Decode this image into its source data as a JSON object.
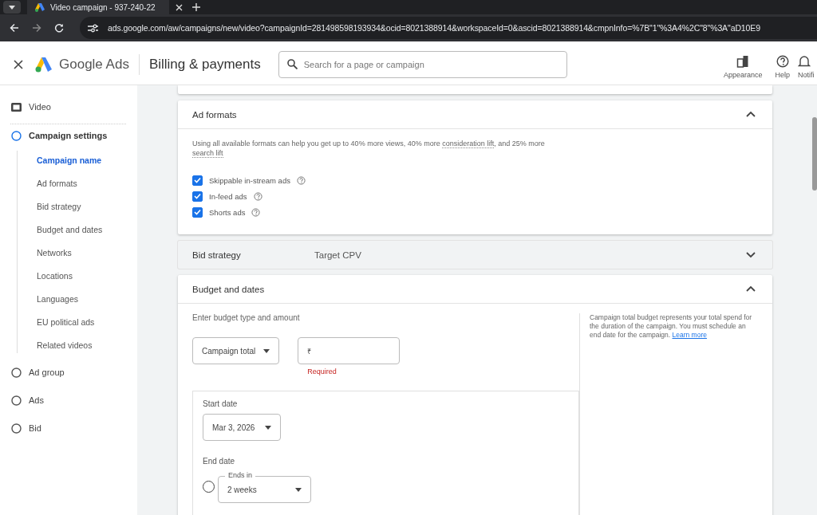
{
  "browser": {
    "tab_title": "Video campaign - 937-240-22",
    "url": "ads.google.com/aw/campaigns/new/video?campaignId=281498598193934&ocid=8021388914&workspaceId=0&ascid=8021388914&cmpnInfo=%7B\"1\"%3A4%2C\"8\"%3A\"aD10E9"
  },
  "header": {
    "app_name": "Google Ads",
    "page_title": "Billing & payments",
    "search": {
      "placeholder": "Search for a page or campaign"
    },
    "actions": [
      {
        "kind": "appearance",
        "label": "Appearance"
      },
      {
        "kind": "help",
        "label": "Help"
      },
      {
        "kind": "bell",
        "label": "Notifi"
      }
    ]
  },
  "sidebar": {
    "items": [
      {
        "kind": "video",
        "label": "Video",
        "selected": false
      },
      {
        "kind": "step",
        "label": "Campaign settings",
        "selected": true,
        "children": [
          {
            "label": "Campaign name",
            "selected": true
          },
          {
            "label": "Ad formats",
            "selected": false
          },
          {
            "label": "Bid strategy",
            "selected": false
          },
          {
            "label": "Budget and dates",
            "selected": false
          },
          {
            "label": "Networks",
            "selected": false
          },
          {
            "label": "Locations",
            "selected": false
          },
          {
            "label": "Languages",
            "selected": false
          },
          {
            "label": "EU political ads",
            "selected": false
          },
          {
            "label": "Related videos",
            "selected": false
          }
        ]
      },
      {
        "kind": "step",
        "label": "Ad group",
        "selected": false
      },
      {
        "kind": "step",
        "label": "Ads",
        "selected": false
      },
      {
        "kind": "step",
        "label": "Bid",
        "selected": false
      }
    ]
  },
  "ad_formats": {
    "title": "Ad formats",
    "expanded": true,
    "description": [
      {
        "kind": "plain",
        "text": "Using all available formats can help you get up to 40% more views, 40% more "
      },
      {
        "kind": "term",
        "text": "consideration lift"
      },
      {
        "kind": "plain",
        "text": ", and 25% more "
      },
      {
        "kind": "term",
        "text": "search lift"
      }
    ],
    "formats": [
      {
        "label": "Skippable in-stream ads",
        "checked": true
      },
      {
        "label": "In-feed ads",
        "checked": true
      },
      {
        "label": "Shorts ads",
        "checked": true
      }
    ]
  },
  "bid_strategy": {
    "title": "Bid strategy",
    "value": "Target CPV",
    "expanded": false
  },
  "budget": {
    "title": "Budget and dates",
    "expanded": true,
    "prompt": "Enter budget type and amount",
    "budget_type": "Campaign total",
    "amount": {
      "prefix": "₹",
      "error": "Required"
    },
    "info": "Campaign total budget represents your total spend for the duration of the campaign. You must schedule an end date for the campaign.",
    "info_link": "Learn more",
    "start_date": {
      "label": "Start date",
      "value": "Mar 3, 2026"
    },
    "end_date": {
      "label": "End date",
      "options": [
        {
          "selected": false,
          "field_label": "Ends in",
          "value": "2 weeks"
        }
      ]
    }
  }
}
